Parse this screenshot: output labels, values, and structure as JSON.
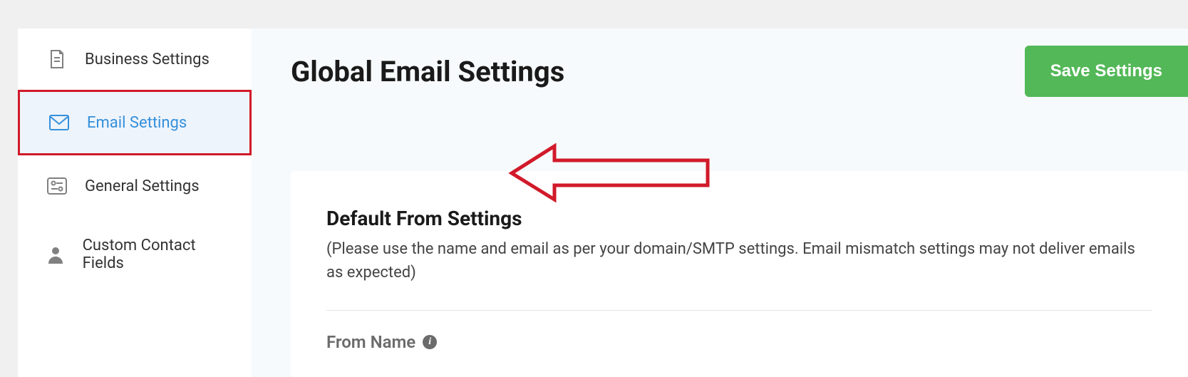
{
  "sidebar": {
    "items": [
      {
        "label": "Business Settings"
      },
      {
        "label": "Email Settings"
      },
      {
        "label": "General Settings"
      },
      {
        "label": "Custom Contact Fields"
      }
    ]
  },
  "header": {
    "title": "Global Email Settings",
    "save_label": "Save Settings"
  },
  "section": {
    "title": "Default From Settings",
    "desc": "(Please use the name and email as per your domain/SMTP settings. Email mismatch settings may not deliver emails as expected)"
  },
  "field": {
    "from_name_label": "From Name"
  }
}
